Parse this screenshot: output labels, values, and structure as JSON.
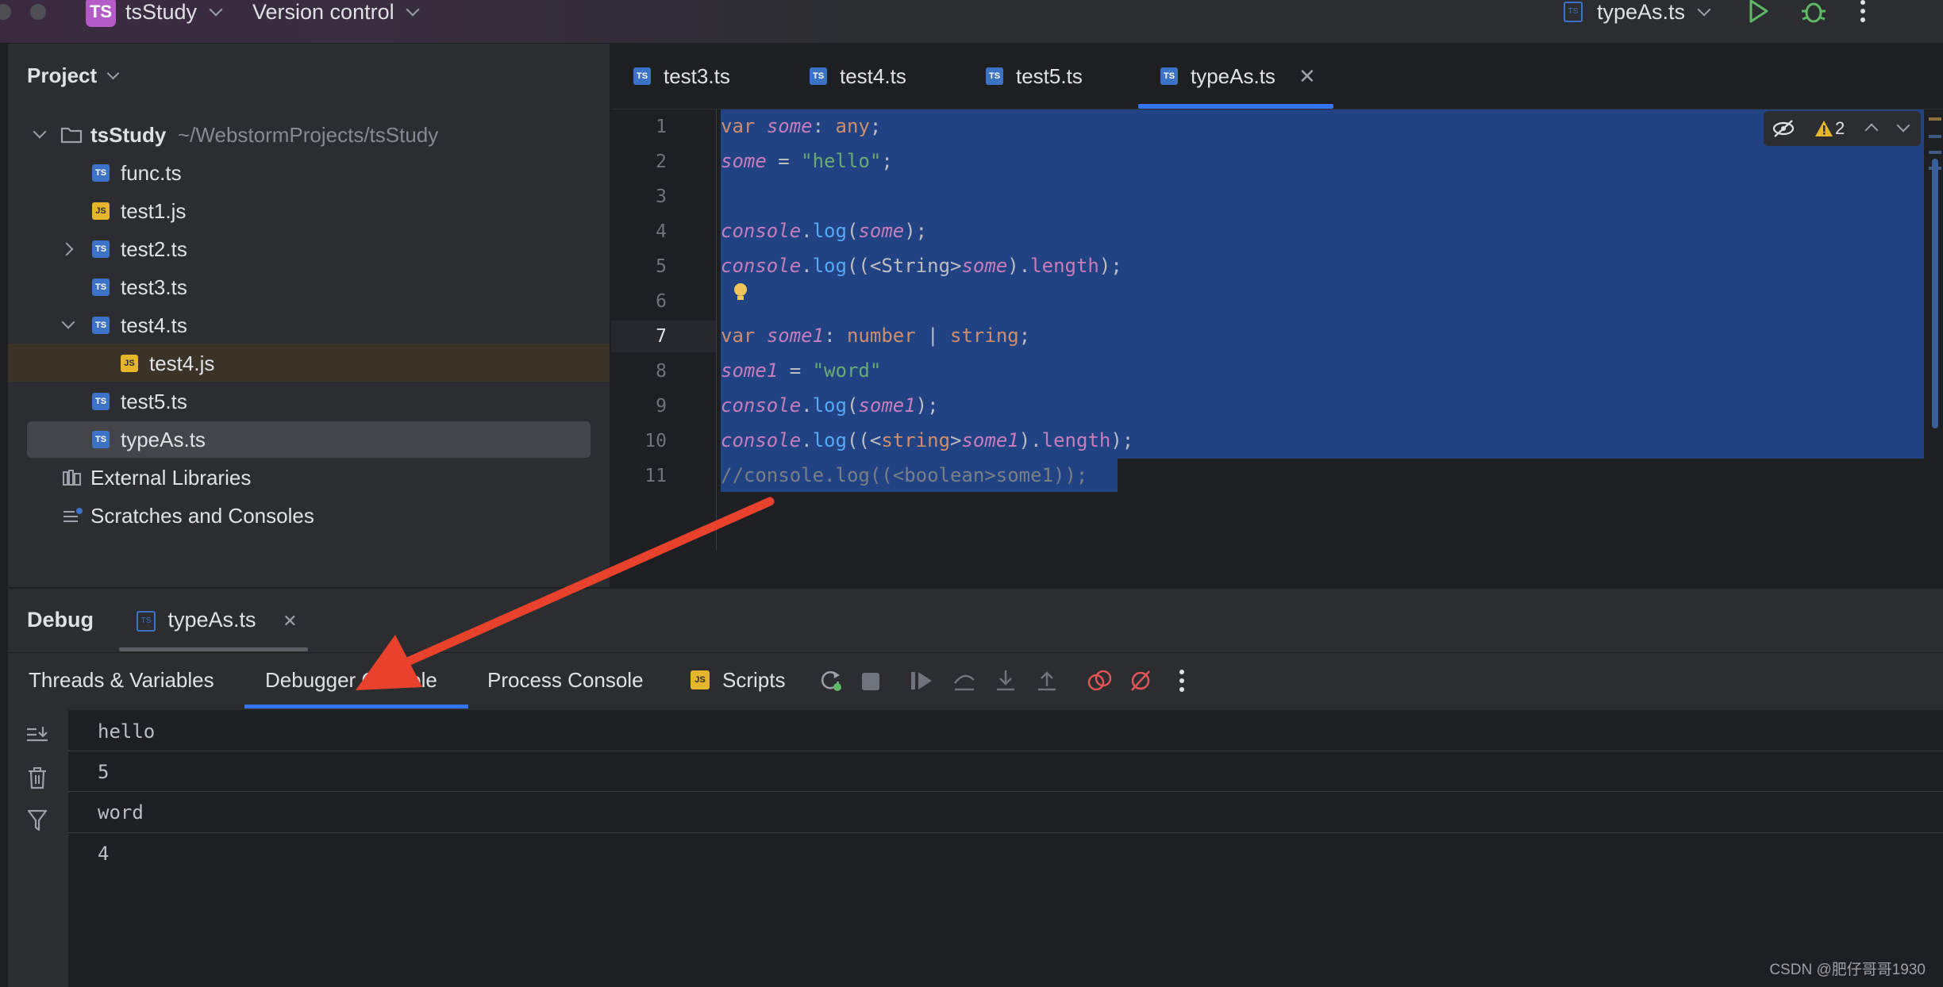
{
  "titlebar": {
    "project_badge": "TS",
    "project_name": "tsStudy",
    "vcs_label": "Version control",
    "run_config": "typeAs.ts",
    "run_icon": "play-icon",
    "debug_icon": "bug-icon"
  },
  "sidebar": {
    "title": "Project",
    "root": {
      "name": "tsStudy",
      "path": "~/WebstormProjects/tsStudy"
    },
    "items": [
      {
        "label": "func.ts",
        "type": "TS"
      },
      {
        "label": "test1.js",
        "type": "JS"
      },
      {
        "label": "test2.ts",
        "type": "TS"
      },
      {
        "label": "test3.ts",
        "type": "TS"
      },
      {
        "label": "test4.ts",
        "type": "TS"
      },
      {
        "label": "test4.js",
        "type": "JS"
      },
      {
        "label": "test5.ts",
        "type": "TS"
      },
      {
        "label": "typeAs.ts",
        "type": "TS"
      }
    ],
    "external_libraries": "External Libraries",
    "scratches": "Scratches and Consoles"
  },
  "editor": {
    "tabs": [
      {
        "label": "test3.ts"
      },
      {
        "label": "test4.ts"
      },
      {
        "label": "test5.ts"
      },
      {
        "label": "typeAs.ts"
      }
    ],
    "warning_count": "2",
    "line_numbers": [
      "1",
      "2",
      "3",
      "4",
      "5",
      "6",
      "7",
      "8",
      "9",
      "10",
      "11"
    ]
  },
  "debug": {
    "title": "Debug",
    "session_tab": "typeAs.ts",
    "tabs": {
      "threads": "Threads & Variables",
      "debugger_console": "Debugger Console",
      "process_console": "Process Console",
      "scripts": "Scripts"
    },
    "console_output": [
      "hello",
      "5",
      "word",
      "4"
    ]
  },
  "colors": {
    "accent": "#3574f0",
    "badge": "#b35cc8",
    "arrow": "#e8412c"
  },
  "watermark": "CSDN @肥仔哥哥1930"
}
